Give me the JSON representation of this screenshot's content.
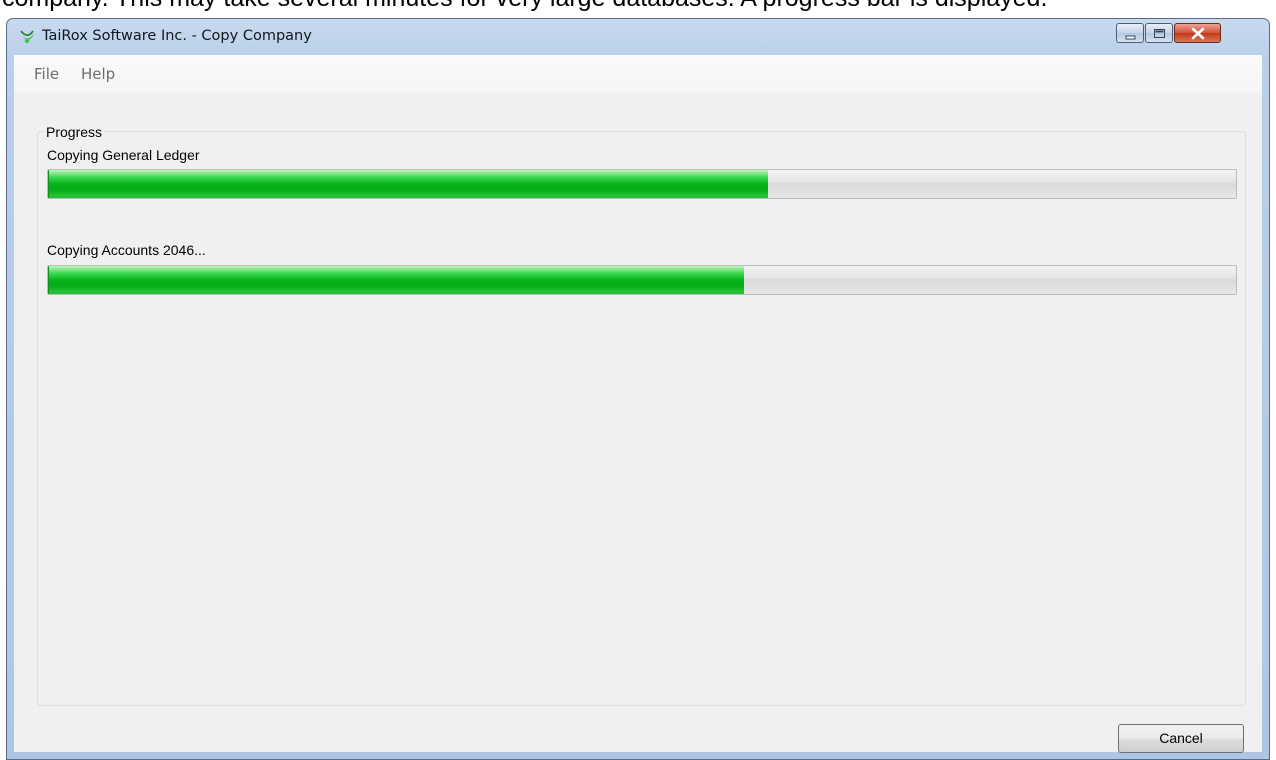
{
  "document_text": "company. This may take several minutes for very large databases. A progress bar is displayed.",
  "window": {
    "title": "TaiRox Software Inc. - Copy Company",
    "icon": "tairox-logo-icon",
    "controls": {
      "minimize_icon": "minimize-icon",
      "maximize_icon": "maximize-icon",
      "close_icon": "close-icon"
    }
  },
  "menu": {
    "items": [
      {
        "label": "File"
      },
      {
        "label": "Help"
      }
    ]
  },
  "progress_group": {
    "legend": "Progress",
    "tasks": [
      {
        "label": "Copying General Ledger",
        "percent": 60.6
      },
      {
        "label": "Copying Accounts 2046...",
        "percent": 58.6
      }
    ]
  },
  "buttons": {
    "cancel_label": "Cancel"
  },
  "colors": {
    "progress_fill": "#08b31c",
    "title_bar": "#b9cfea",
    "close_button": "#c23818"
  }
}
